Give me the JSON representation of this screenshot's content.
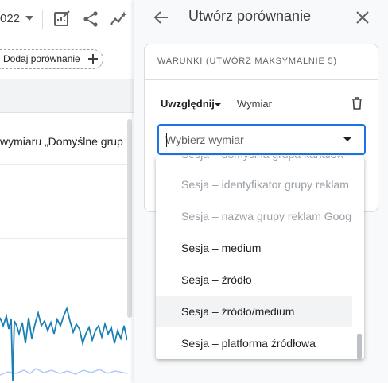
{
  "report": {
    "date_suffix": "022",
    "add_comparison_label": "Dodaj porównanie",
    "dimension_header": "wymiaru „Domyślne grup"
  },
  "panel": {
    "title": "Utwórz porównanie",
    "conditions_header": "WARUNKI (UTWÓRZ MAKSYMALNIE 5)",
    "include_label": "Uwzględnij",
    "dimension_label": "Wymiar",
    "select_placeholder": "Wybierz wymiar"
  },
  "dropdown": {
    "items": [
      {
        "label": "Sesja – domyślna grupa kanałów",
        "state": "disabled"
      },
      {
        "label": "Sesja – identyfikator grupy reklam",
        "state": "disabled"
      },
      {
        "label": "Sesja – nazwa grupy reklam Google Ads",
        "state": "disabled"
      },
      {
        "label": "Sesja – medium",
        "state": "enabled"
      },
      {
        "label": "Sesja – źródło",
        "state": "enabled"
      },
      {
        "label": "Sesja – źródło/medium",
        "state": "hover"
      },
      {
        "label": "Sesja – platforma źródłowa",
        "state": "enabled"
      }
    ]
  },
  "icons": [
    "caret-down-icon",
    "edit-report-icon",
    "share-icon",
    "insights-icon",
    "plus-icon",
    "arrow-back-icon",
    "close-icon",
    "trash-icon"
  ],
  "colors": {
    "accent": "#1a73e8",
    "chart_line_dark": "#1a7fb5",
    "chart_line_light": "#aecbfa",
    "panel_bg": "#f8f9fa",
    "hover_bg": "#f1f3f4"
  }
}
